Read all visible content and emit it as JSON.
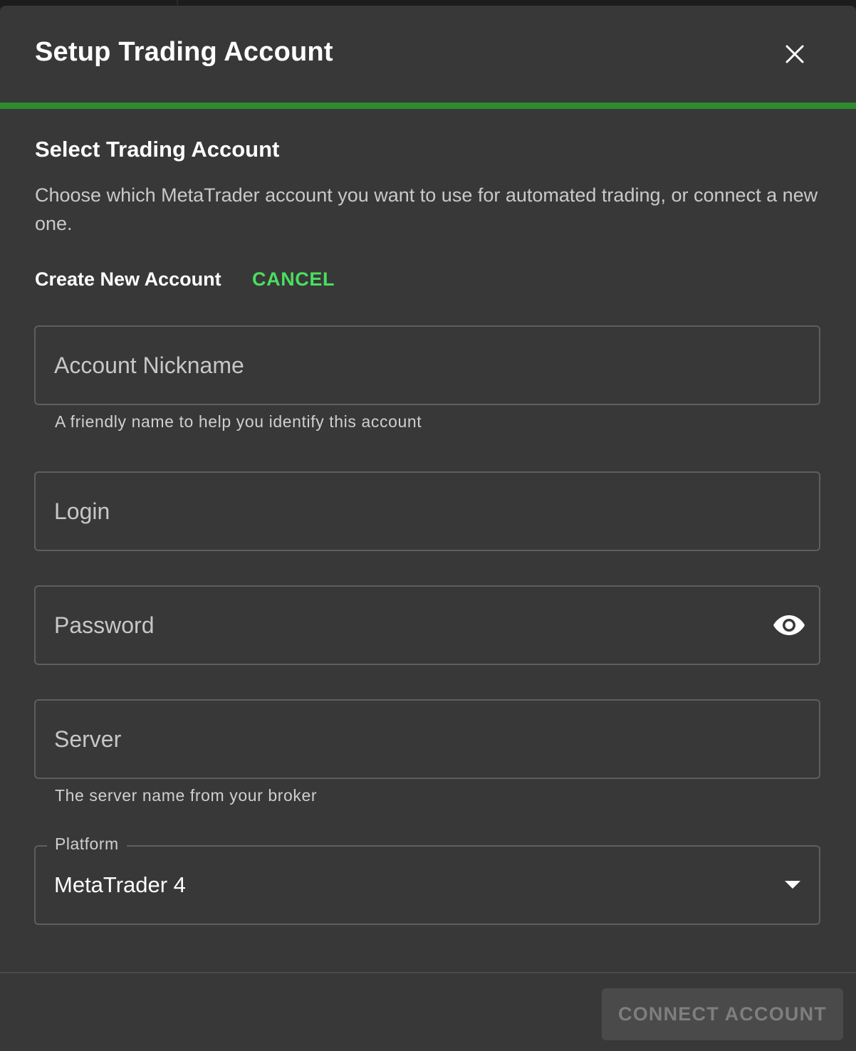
{
  "dialog": {
    "title": "Setup Trading Account",
    "close_icon": "close-icon"
  },
  "colors": {
    "accent": "#2e8b2e",
    "cancel": "#4ade5f",
    "surface": "#383838"
  },
  "section": {
    "title": "Select Trading Account",
    "description": "Choose which MetaTrader account you want to use for automated trading, or connect a new one."
  },
  "create": {
    "label": "Create New Account",
    "cancel_label": "CANCEL"
  },
  "fields": {
    "nickname": {
      "placeholder": "Account Nickname",
      "value": "",
      "helper": "A friendly name to help you identify this account"
    },
    "login": {
      "placeholder": "Login",
      "value": ""
    },
    "password": {
      "placeholder": "Password",
      "value": "",
      "toggle_icon": "eye-icon"
    },
    "server": {
      "placeholder": "Server",
      "value": "",
      "helper": "The server name from your broker"
    },
    "platform": {
      "label": "Platform",
      "value": "MetaTrader 4",
      "arrow_icon": "caret-down-icon"
    }
  },
  "footer": {
    "connect_label": "CONNECT ACCOUNT"
  }
}
